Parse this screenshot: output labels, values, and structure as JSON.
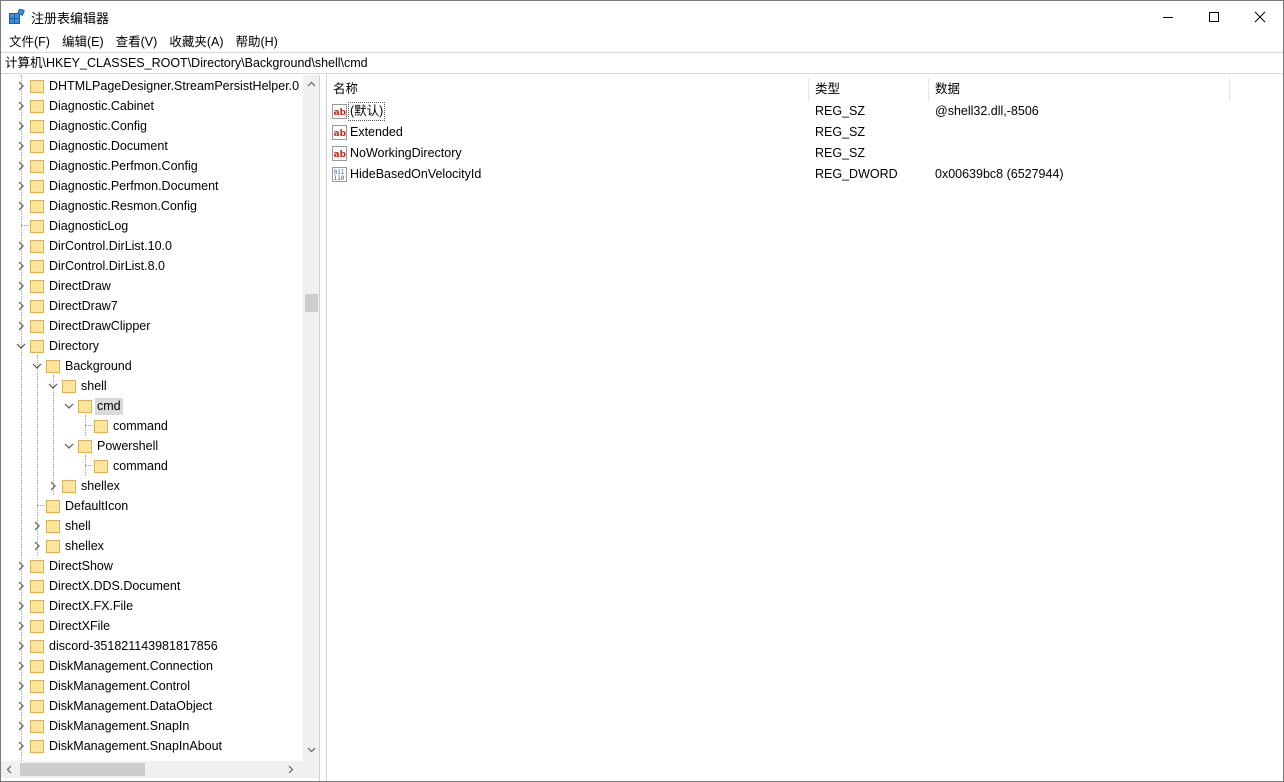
{
  "window": {
    "title": "注册表编辑器"
  },
  "menu": [
    {
      "label": "文件(F)"
    },
    {
      "label": "编辑(E)"
    },
    {
      "label": "查看(V)"
    },
    {
      "label": "收藏夹(A)"
    },
    {
      "label": "帮助(H)"
    }
  ],
  "address": {
    "path": "计算机\\HKEY_CLASSES_ROOT\\Directory\\Background\\shell\\cmd"
  },
  "tree": {
    "items": [
      {
        "label": "DHTMLPageDesigner.StreamPersistHelper.0",
        "depth": 0,
        "expander": "collapsed"
      },
      {
        "label": "Diagnostic.Cabinet",
        "depth": 0,
        "expander": "collapsed"
      },
      {
        "label": "Diagnostic.Config",
        "depth": 0,
        "expander": "collapsed"
      },
      {
        "label": "Diagnostic.Document",
        "depth": 0,
        "expander": "collapsed"
      },
      {
        "label": "Diagnostic.Perfmon.Config",
        "depth": 0,
        "expander": "collapsed"
      },
      {
        "label": "Diagnostic.Perfmon.Document",
        "depth": 0,
        "expander": "collapsed"
      },
      {
        "label": "Diagnostic.Resmon.Config",
        "depth": 0,
        "expander": "collapsed"
      },
      {
        "label": "DiagnosticLog",
        "depth": 0,
        "expander": "none"
      },
      {
        "label": "DirControl.DirList.10.0",
        "depth": 0,
        "expander": "collapsed"
      },
      {
        "label": "DirControl.DirList.8.0",
        "depth": 0,
        "expander": "collapsed"
      },
      {
        "label": "DirectDraw",
        "depth": 0,
        "expander": "collapsed"
      },
      {
        "label": "DirectDraw7",
        "depth": 0,
        "expander": "collapsed"
      },
      {
        "label": "DirectDrawClipper",
        "depth": 0,
        "expander": "collapsed"
      },
      {
        "label": "Directory",
        "depth": 0,
        "expander": "expanded"
      },
      {
        "label": "Background",
        "depth": 1,
        "expander": "expanded"
      },
      {
        "label": "shell",
        "depth": 2,
        "expander": "expanded"
      },
      {
        "label": "cmd",
        "depth": 3,
        "expander": "expanded",
        "selected": true
      },
      {
        "label": "command",
        "depth": 4,
        "expander": "none"
      },
      {
        "label": "Powershell",
        "depth": 3,
        "expander": "expanded"
      },
      {
        "label": "command",
        "depth": 4,
        "expander": "none"
      },
      {
        "label": "shellex",
        "depth": 2,
        "expander": "collapsed"
      },
      {
        "label": "DefaultIcon",
        "depth": 1,
        "expander": "none"
      },
      {
        "label": "shell",
        "depth": 1,
        "expander": "collapsed"
      },
      {
        "label": "shellex",
        "depth": 1,
        "expander": "collapsed"
      },
      {
        "label": "DirectShow",
        "depth": 0,
        "expander": "collapsed"
      },
      {
        "label": "DirectX.DDS.Document",
        "depth": 0,
        "expander": "collapsed"
      },
      {
        "label": "DirectX.FX.File",
        "depth": 0,
        "expander": "collapsed"
      },
      {
        "label": "DirectXFile",
        "depth": 0,
        "expander": "collapsed"
      },
      {
        "label": "discord-351821143981817856",
        "depth": 0,
        "expander": "collapsed"
      },
      {
        "label": "DiskManagement.Connection",
        "depth": 0,
        "expander": "collapsed"
      },
      {
        "label": "DiskManagement.Control",
        "depth": 0,
        "expander": "collapsed"
      },
      {
        "label": "DiskManagement.DataObject",
        "depth": 0,
        "expander": "collapsed"
      },
      {
        "label": "DiskManagement.SnapIn",
        "depth": 0,
        "expander": "collapsed"
      },
      {
        "label": "DiskManagement.SnapInAbout",
        "depth": 0,
        "expander": "collapsed"
      }
    ]
  },
  "values": {
    "columns": {
      "name": "名称",
      "type": "类型",
      "data": "数据"
    },
    "rows": [
      {
        "icon": "string-value-icon",
        "name": "(默认)",
        "type": "REG_SZ",
        "data": "@shell32.dll,-8506"
      },
      {
        "icon": "string-value-icon",
        "name": "Extended",
        "type": "REG_SZ",
        "data": ""
      },
      {
        "icon": "string-value-icon",
        "name": "NoWorkingDirectory",
        "type": "REG_SZ",
        "data": ""
      },
      {
        "icon": "binary-value-icon",
        "name": "HideBasedOnVelocityId",
        "type": "REG_DWORD",
        "data": "0x00639bc8 (6527944)"
      }
    ]
  },
  "colors": {
    "folder_fill": "#ffe49c",
    "folder_stroke": "#dcb056",
    "selection": "#d9d9d9",
    "string_icon_red": "#c42b1c",
    "binary_icon_blue": "#1e5fa8"
  }
}
